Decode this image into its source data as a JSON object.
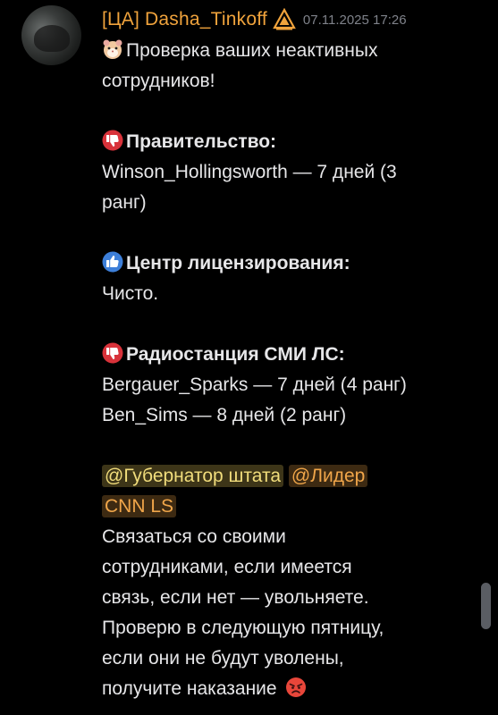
{
  "message": {
    "author": "[ЦА] Dasha_Tinkoff",
    "timestamp": "07.11.2025 17:26",
    "intro": "Проверка ваших неактивных",
    "intro_cont": "сотрудников!",
    "sections": [
      {
        "icon": "thumbs-down-icon",
        "title": "Правительство:",
        "lines": [
          "Winson_Hollingsworth — 7 дней (3",
          "ранг)"
        ]
      },
      {
        "icon": "thumbs-up-icon",
        "title": "Центр лицензирования:",
        "lines": [
          "Чисто."
        ]
      },
      {
        "icon": "thumbs-down-icon",
        "title": "Радиостанция СМИ ЛС:",
        "lines": [
          "Bergauer_Sparks — 7 дней (4 ранг)",
          "Ben_Sims — 8 дней (2 ранг)"
        ]
      }
    ],
    "mentions": {
      "governor": "@Губернатор штата",
      "cnn_part1": "@Лидер",
      "cnn_part2": "CNN LS"
    },
    "closing": [
      "Связаться со своими",
      "сотрудниками, если имеется",
      "связь, если нет — увольняете.",
      "Проверю в следующую пятницу,",
      "если они не будут уволены,",
      "получите наказание"
    ]
  },
  "colors": {
    "background": "#000000",
    "username": "#f0a33c",
    "timestamp": "#7f828a",
    "mention_governor_bg": "#3d3518",
    "mention_cnn_bg": "#3d2a12"
  }
}
